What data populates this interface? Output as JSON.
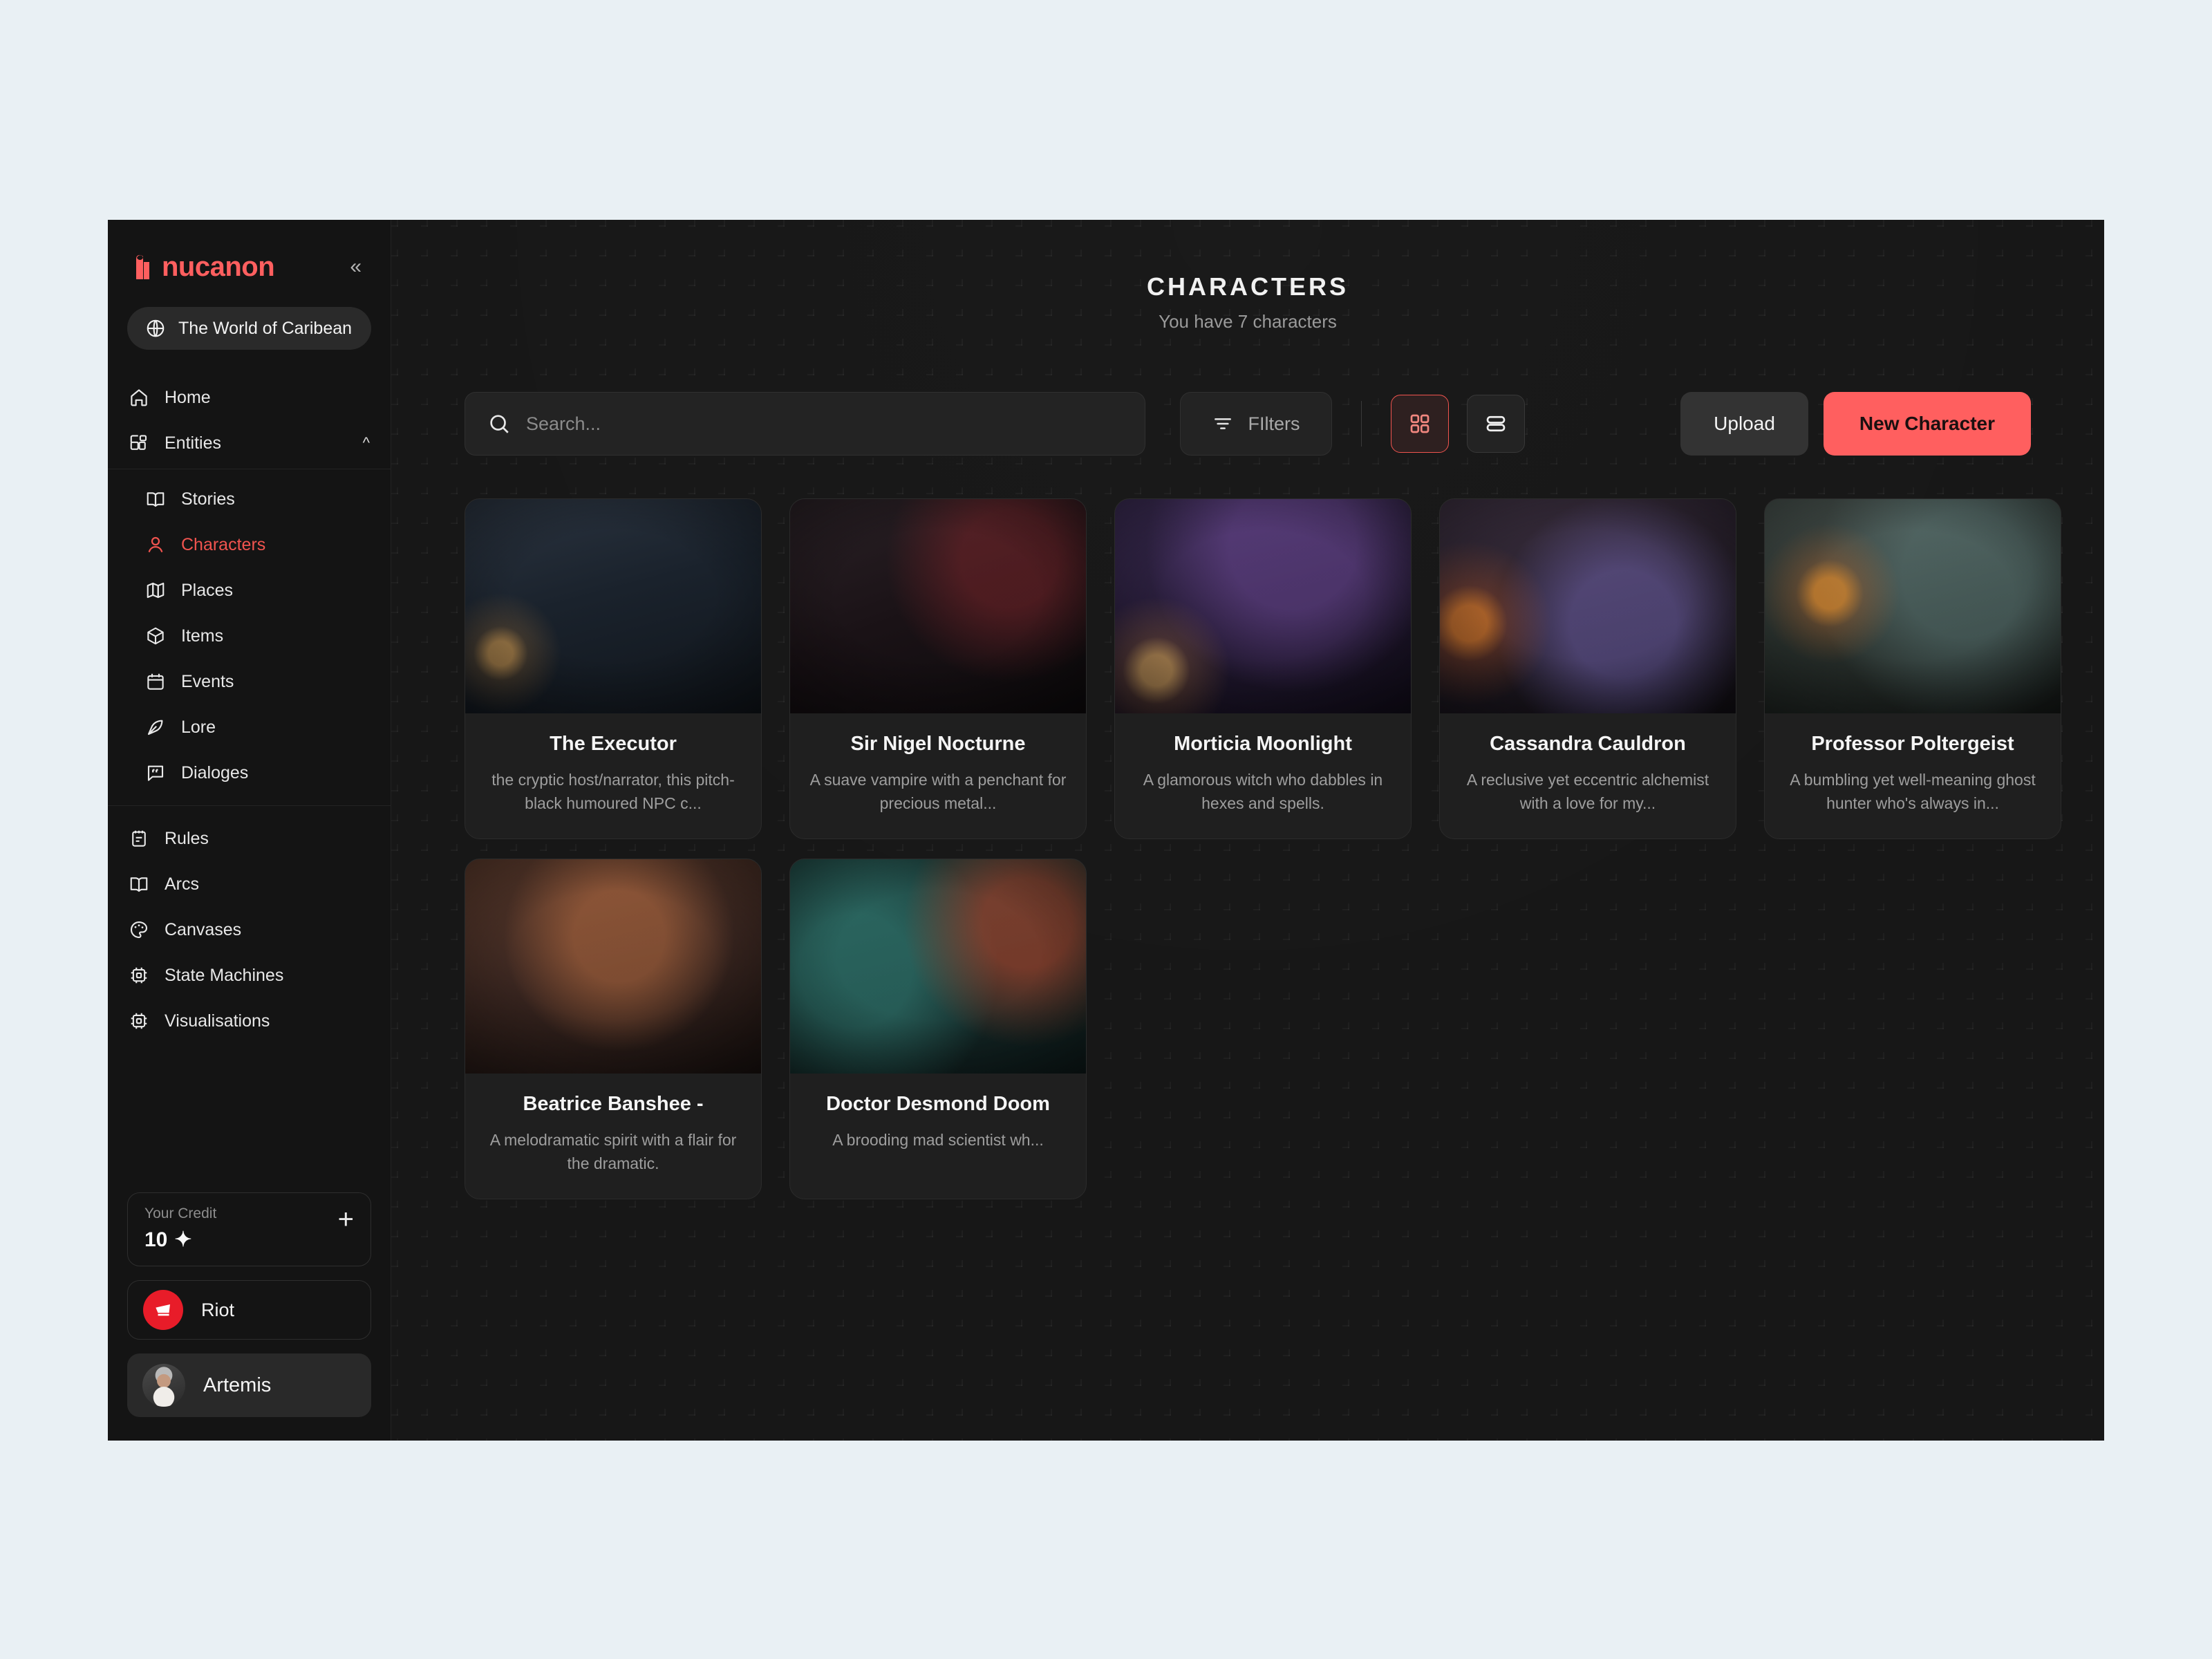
{
  "brand": {
    "name": "nucanon",
    "accent": "#ff5f5f",
    "collapse_icon": "chevrons-left-icon"
  },
  "sidebar": {
    "world": {
      "label": "The World of Caribean",
      "icon": "globe-icon"
    },
    "primary": [
      {
        "label": "Home",
        "icon": "home-icon"
      }
    ],
    "entities": {
      "label": "Entities",
      "icon": "blocks-icon",
      "chevron": "chevron-up-icon",
      "expanded": true,
      "items": [
        {
          "label": "Stories",
          "icon": "book-open-icon",
          "active": false
        },
        {
          "label": "Characters",
          "icon": "user-icon",
          "active": true
        },
        {
          "label": "Places",
          "icon": "map-icon",
          "active": false
        },
        {
          "label": "Items",
          "icon": "box-icon",
          "active": false
        },
        {
          "label": "Events",
          "icon": "calendar-icon",
          "active": false
        },
        {
          "label": "Lore",
          "icon": "feather-icon",
          "active": false
        },
        {
          "label": "Dialoges",
          "icon": "message-quote-icon",
          "active": false
        }
      ]
    },
    "lower": [
      {
        "label": "Rules",
        "icon": "notebook-icon"
      },
      {
        "label": "Arcs",
        "icon": "book-open-icon"
      },
      {
        "label": "Canvases",
        "icon": "palette-icon"
      },
      {
        "label": "State Machines",
        "icon": "cpu-icon"
      },
      {
        "label": "Visualisations",
        "icon": "cpu-icon"
      }
    ],
    "credit": {
      "label": "Your Credit",
      "value": "10",
      "sparkle": "✦",
      "add_icon": "plus-icon"
    },
    "org": {
      "name": "Riot",
      "icon": "riot-fist-icon",
      "color": "#e81c29"
    },
    "user": {
      "name": "Artemis",
      "avatar": "user-avatar"
    }
  },
  "header": {
    "title": "CHARACTERS",
    "subtitle": "You have 7 characters"
  },
  "toolbar": {
    "search": {
      "placeholder": "Search...",
      "value": "",
      "icon": "search-icon"
    },
    "filters": {
      "label": "FIlters",
      "icon": "filter-icon"
    },
    "view_grid": {
      "icon": "grid-view-icon",
      "active": true
    },
    "view_list": {
      "icon": "list-view-icon",
      "active": false
    },
    "upload": {
      "label": "Upload"
    },
    "new_character": {
      "label": "New Character"
    }
  },
  "cards": [
    {
      "title": "The Executor",
      "desc": "the cryptic host/narrator, this pitch-black humoured NPC c...",
      "art": "art-1"
    },
    {
      "title": "Sir Nigel Nocturne",
      "desc": "A suave vampire with a penchant for precious metal...",
      "art": "art-2"
    },
    {
      "title": "Morticia Moonlight",
      "desc": "A glamorous witch who dabbles in hexes and spells.",
      "art": "art-3"
    },
    {
      "title": "Cassandra Cauldron",
      "desc": "A reclusive yet eccentric alchemist with a love for my...",
      "art": "art-4"
    },
    {
      "title": "Professor Poltergeist",
      "desc": "A bumbling yet well-meaning ghost hunter who's always in...",
      "art": "art-5"
    },
    {
      "title": "Beatrice Banshee -",
      "desc": "A melodramatic spirit with a flair for the dramatic.",
      "art": "art-6"
    },
    {
      "title": "Doctor Desmond Doom",
      "desc": "A brooding mad scientist wh...",
      "art": "art-7"
    }
  ]
}
